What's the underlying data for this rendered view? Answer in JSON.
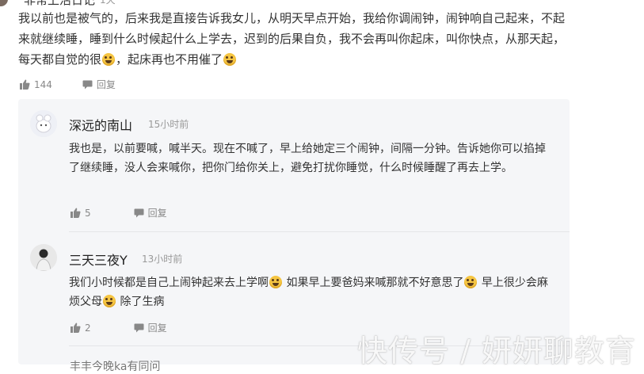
{
  "top_comment": {
    "name": "非常上活日记",
    "time": "1天"
  },
  "main_comment": {
    "text_1": "我以前也是被气的，后来我是直接告诉我女儿，从明天早点开始，我给你调闹钟，闹钟响自己起来，不起来就继续睡，睡到什么时候起什么上学去，迟到的后果自负，我不会再叫你起床，叫你快点，从那天起，每天都自觉的很",
    "text_2": "，起床再也不用催了",
    "emoji": "laughing-emoji",
    "likes": "144",
    "reply_label": "回复"
  },
  "replies": [
    {
      "name": "深远的南山",
      "time": "15小时前",
      "text": "我也是，以前要喊，喊半天。现在不喊了，早上给她定三个闹钟，间隔一分钟。告诉她你可以掐掉了继续睡，没人会来喊你，把你门给你关上，避免打扰你睡觉，什么时候睡醒了再去上学。",
      "likes": "5",
      "reply_label": "回复"
    },
    {
      "name": "三天三夜Y",
      "time": "13小时前",
      "text_1": "我们小时候都是自己上闹钟起来去上学啊",
      "text_2": " 如果早上要爸妈来喊那就不好意思了",
      "text_3": " 早上很少会麻烦父母",
      "text_4": " 除了生病",
      "likes": "2",
      "reply_label": "回复"
    }
  ],
  "bottom_comment": {
    "name": "丰丰今晚ka有同问"
  },
  "watermark": "快传号 / 妍妍聊教育",
  "colors": {
    "background": "#ffffff",
    "reply_background": "#f5f6f8",
    "text": "#333333",
    "muted": "#999999",
    "emoji": "#f5c542"
  }
}
